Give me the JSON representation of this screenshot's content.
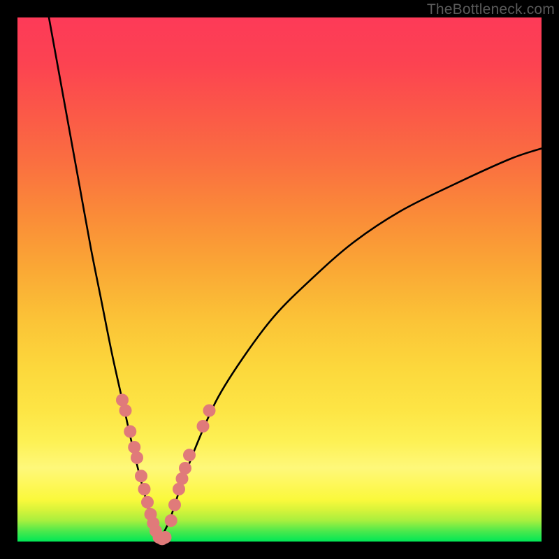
{
  "watermark": "TheBottleneck.com",
  "colors": {
    "frame": "#000000",
    "curve": "#000000",
    "marker_fill": "#e07a7a",
    "marker_stroke": "#d46060"
  },
  "chart_data": {
    "type": "line",
    "title": "",
    "xlabel": "",
    "ylabel": "",
    "xlim": [
      0,
      100
    ],
    "ylim": [
      0,
      100
    ],
    "grid": false,
    "legend": false,
    "note": "Bottleneck-style V-curve. x is a normalized component-balance axis; y is percent bottleneck (0 at the notch ≈ x 27, rising toward 100 at extremes). Gradient background: green (low y) → red (high y).",
    "series": [
      {
        "name": "left-branch",
        "x": [
          6,
          8,
          10,
          12,
          14,
          16,
          18,
          20,
          22,
          24,
          26,
          27
        ],
        "y": [
          100,
          89,
          78,
          67,
          56,
          46,
          36,
          27,
          18,
          10,
          3,
          0
        ]
      },
      {
        "name": "right-branch",
        "x": [
          27,
          29,
          31,
          34,
          38,
          43,
          49,
          56,
          64,
          73,
          83,
          94,
          100
        ],
        "y": [
          0,
          4,
          10,
          18,
          27,
          35,
          43,
          50,
          57,
          63,
          68,
          73,
          75
        ]
      }
    ],
    "markers": {
      "name": "highlighted-points",
      "note": "salmon dots clustered near the notch on both branches",
      "points": [
        {
          "x": 20.0,
          "y": 27
        },
        {
          "x": 20.6,
          "y": 25
        },
        {
          "x": 21.5,
          "y": 21
        },
        {
          "x": 22.3,
          "y": 18
        },
        {
          "x": 22.8,
          "y": 16
        },
        {
          "x": 23.6,
          "y": 12.5
        },
        {
          "x": 24.2,
          "y": 10
        },
        {
          "x": 24.8,
          "y": 7.5
        },
        {
          "x": 25.4,
          "y": 5.2
        },
        {
          "x": 25.9,
          "y": 3.5
        },
        {
          "x": 26.4,
          "y": 2
        },
        {
          "x": 27.0,
          "y": 0.8
        },
        {
          "x": 27.6,
          "y": 0.5
        },
        {
          "x": 28.2,
          "y": 0.8
        },
        {
          "x": 29.3,
          "y": 4
        },
        {
          "x": 30.0,
          "y": 7
        },
        {
          "x": 30.8,
          "y": 10
        },
        {
          "x": 31.4,
          "y": 12
        },
        {
          "x": 32.0,
          "y": 14
        },
        {
          "x": 32.8,
          "y": 16.5
        },
        {
          "x": 35.4,
          "y": 22
        },
        {
          "x": 36.6,
          "y": 25
        }
      ]
    }
  }
}
